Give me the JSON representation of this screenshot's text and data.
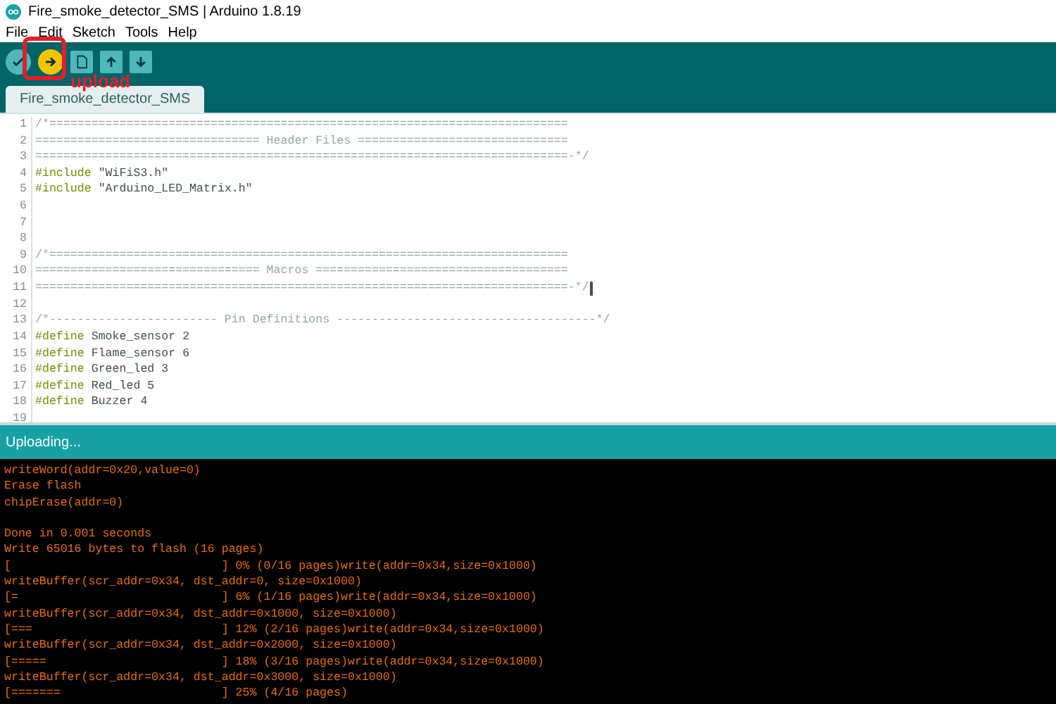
{
  "window": {
    "title": "Fire_smoke_detector_SMS | Arduino 1.8.19"
  },
  "menu": [
    "File",
    "Edit",
    "Sketch",
    "Tools",
    "Help"
  ],
  "toolbar": {
    "buttons": [
      {
        "kind": "verify",
        "highlighted": false
      },
      {
        "kind": "upload",
        "highlighted": true
      },
      {
        "kind": "new",
        "highlighted": false
      },
      {
        "kind": "open",
        "highlighted": false
      },
      {
        "kind": "save",
        "highlighted": false
      }
    ],
    "annotation": {
      "label": "upload"
    }
  },
  "tabs": [
    {
      "label": "Fire_smoke_detector_SMS",
      "selected": true
    }
  ],
  "editor": {
    "lines": [
      {
        "number": "1",
        "kind": "comment",
        "text": "/*==========================================================================",
        "cursor": false
      },
      {
        "number": "2",
        "kind": "comment",
        "text": "================================ Header Files ==============================",
        "cursor": false
      },
      {
        "number": "3",
        "kind": "comment",
        "text": "============================================================================-*/",
        "cursor": false
      },
      {
        "number": "4",
        "kind": "directive",
        "keyword": "#include",
        "text": " \"WiFiS3.h\"",
        "cursor": false
      },
      {
        "number": "5",
        "kind": "directive",
        "keyword": "#include",
        "text": " \"Arduino_LED_Matrix.h\"",
        "cursor": false
      },
      {
        "number": "6",
        "kind": "blank",
        "cursor": false
      },
      {
        "number": "7",
        "kind": "blank",
        "cursor": false
      },
      {
        "number": "8",
        "kind": "blank",
        "cursor": false
      },
      {
        "number": "9",
        "kind": "comment",
        "text": "/*==========================================================================",
        "cursor": false
      },
      {
        "number": "10",
        "kind": "comment",
        "text": "================================ Macros ====================================",
        "cursor": false
      },
      {
        "number": "11",
        "kind": "comment",
        "text": "============================================================================-*/",
        "cursor": true
      },
      {
        "number": "12",
        "kind": "blank",
        "cursor": false
      },
      {
        "number": "13",
        "kind": "comment",
        "text": "/*------------------------ Pin Definitions -------------------------------------*/",
        "cursor": false
      },
      {
        "number": "14",
        "kind": "directive",
        "keyword": "#define",
        "text": " Smoke_sensor 2",
        "cursor": false
      },
      {
        "number": "15",
        "kind": "directive",
        "keyword": "#define",
        "text": " Flame_sensor 6",
        "cursor": false
      },
      {
        "number": "16",
        "kind": "directive",
        "keyword": "#define",
        "text": " Green_led 3",
        "cursor": false
      },
      {
        "number": "17",
        "kind": "directive",
        "keyword": "#define",
        "text": " Red_led 5",
        "cursor": false
      },
      {
        "number": "18",
        "kind": "directive",
        "keyword": "#define",
        "text": " Buzzer 4",
        "cursor": false
      },
      {
        "number": "19",
        "kind": "blank",
        "cursor": false
      }
    ]
  },
  "status_bar": {
    "text": "Uploading..."
  },
  "console": {
    "lines": [
      {
        "kind": "text",
        "text": "writeWord(addr=0x20,value=0)"
      },
      {
        "kind": "text",
        "text": "Erase flash"
      },
      {
        "kind": "text",
        "text": "chipErase(addr=0)"
      },
      {
        "kind": "blank"
      },
      {
        "kind": "text",
        "text": "Done in 0.001 seconds"
      },
      {
        "kind": "text",
        "text": "Write 65016 bytes to flash (16 pages)"
      },
      {
        "kind": "text",
        "text": "[                              ] 0% (0/16 pages)write(addr=0x34,size=0x1000)"
      },
      {
        "kind": "text",
        "text": "writeBuffer(scr_addr=0x34, dst_addr=0, size=0x1000)"
      },
      {
        "kind": "text",
        "text": "[=                             ] 6% (1/16 pages)write(addr=0x34,size=0x1000)"
      },
      {
        "kind": "text",
        "text": "writeBuffer(scr_addr=0x34, dst_addr=0x1000, size=0x1000)"
      },
      {
        "kind": "text",
        "text": "[===                           ] 12% (2/16 pages)write(addr=0x34,size=0x1000)"
      },
      {
        "kind": "text",
        "text": "writeBuffer(scr_addr=0x34, dst_addr=0x2000, size=0x1000)"
      },
      {
        "kind": "text",
        "text": "[=====                         ] 18% (3/16 pages)write(addr=0x34,size=0x1000)"
      },
      {
        "kind": "text",
        "text": "writeBuffer(scr_addr=0x34, dst_addr=0x3000, size=0x1000)"
      },
      {
        "kind": "text",
        "text": "[=======                       ] 25% (4/16 pages)"
      }
    ]
  }
}
